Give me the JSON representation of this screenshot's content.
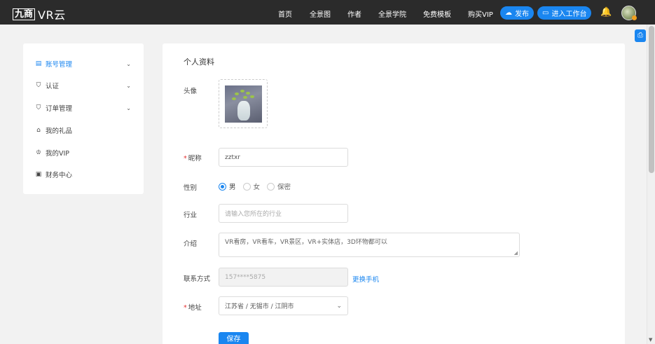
{
  "header": {
    "logo_box": "九商",
    "logo_text": "VR云",
    "nav": [
      "首页",
      "全景图",
      "作者",
      "全景学院",
      "免费模板",
      "购买VIP"
    ],
    "publish_label": "发布",
    "workspace_label": "进入工作台"
  },
  "sidebar": {
    "items": [
      {
        "label": "账号管理",
        "icon": "user-icon",
        "active": true,
        "expandable": true
      },
      {
        "label": "认证",
        "icon": "shield-icon",
        "expandable": true
      },
      {
        "label": "订单管理",
        "icon": "shield-check-icon",
        "expandable": true
      },
      {
        "label": "我的礼品",
        "icon": "gift-icon",
        "expandable": false
      },
      {
        "label": "我的VIP",
        "icon": "crown-icon",
        "expandable": false
      },
      {
        "label": "财务中心",
        "icon": "wallet-icon",
        "expandable": false
      }
    ]
  },
  "profile": {
    "title": "个人资料",
    "avatar_label": "头像",
    "nickname_label": "昵称",
    "nickname_value": "zztxr",
    "gender_label": "性别",
    "gender_options": [
      "男",
      "女",
      "保密"
    ],
    "gender_selected": "男",
    "industry_label": "行业",
    "industry_placeholder": "请输入您所在的行业",
    "intro_label": "介绍",
    "intro_value": "VR看房，VR看车，VR景区，VR+实体店，3D环物都可以",
    "contact_label": "联系方式",
    "contact_value": "157****5875",
    "change_phone_label": "更换手机",
    "address_label": "地址",
    "address_value": "江苏省 / 无锡市 / 江阴市",
    "save_label": "保存"
  },
  "colors": {
    "accent": "#1a86f0",
    "header_bg": "#2b2b2b",
    "required": "#e53030"
  }
}
